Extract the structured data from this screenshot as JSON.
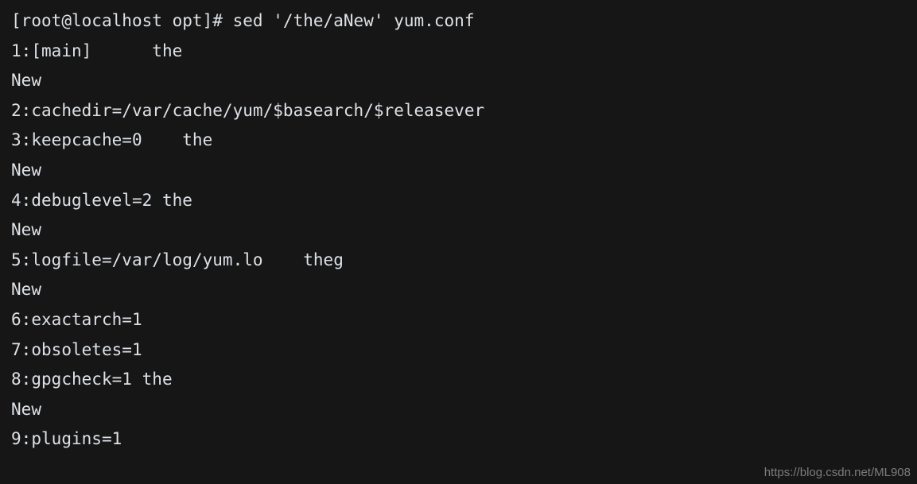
{
  "terminal": {
    "background_color": "#161616",
    "text_color": "#dde1e6",
    "prompt": "[root@localhost opt]#",
    "command": "sed '/the/aNew' yum.conf",
    "lines": [
      "[root@localhost opt]# sed '/the/aNew' yum.conf",
      "1:[main]      the",
      "New",
      "2:cachedir=/var/cache/yum/$basearch/$releasever",
      "3:keepcache=0    the",
      "New",
      "4:debuglevel=2 the",
      "New",
      "5:logfile=/var/log/yum.lo    theg",
      "New",
      "6:exactarch=1",
      "7:obsoletes=1",
      "8:gpgcheck=1 the",
      "New",
      "9:plugins=1"
    ]
  },
  "watermark": {
    "text": "https://blog.csdn.net/ML908",
    "color": "#8e8e8e"
  }
}
